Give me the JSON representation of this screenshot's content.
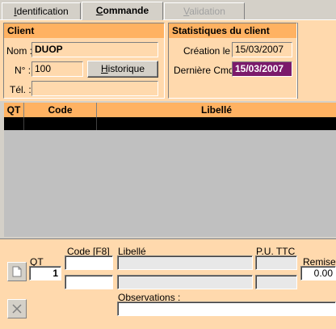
{
  "tabs": [
    {
      "label": "Identification",
      "underline": "I",
      "rest": "dentification"
    },
    {
      "label": "Commande",
      "underline": "C",
      "rest": "ommande"
    },
    {
      "label": "Validation",
      "underline": "V",
      "rest": "alidation"
    }
  ],
  "client": {
    "title": "Client",
    "nom_label": "Nom :",
    "nom_value": "DUOP",
    "num_label": "N° :",
    "num_value": "100",
    "historique_underline": "H",
    "historique_rest": "istorique",
    "tel_label": "Tél. :",
    "tel_value": ""
  },
  "stats": {
    "title": "Statistiques du client",
    "creation_label": "Création le :",
    "creation_value": "15/03/2007",
    "derniere_label": "Dernière Cmd :",
    "derniere_value": "15/03/2007"
  },
  "grid": {
    "columns": [
      "QT",
      "Code",
      "Libellé"
    ]
  },
  "entry": {
    "qt_label": "QT",
    "qt_value": "1",
    "code_label": "Code [F8]",
    "libelle_label": "Libellé",
    "pu_label": "P.U. TTC",
    "remise_label": "Remise",
    "remise_value": "0.00",
    "observations_label": "Observations :"
  },
  "colors": {
    "panel_bg": "#ffd9ad",
    "header_bg": "#ffb262",
    "date_highlight": "#7b1a6b"
  }
}
